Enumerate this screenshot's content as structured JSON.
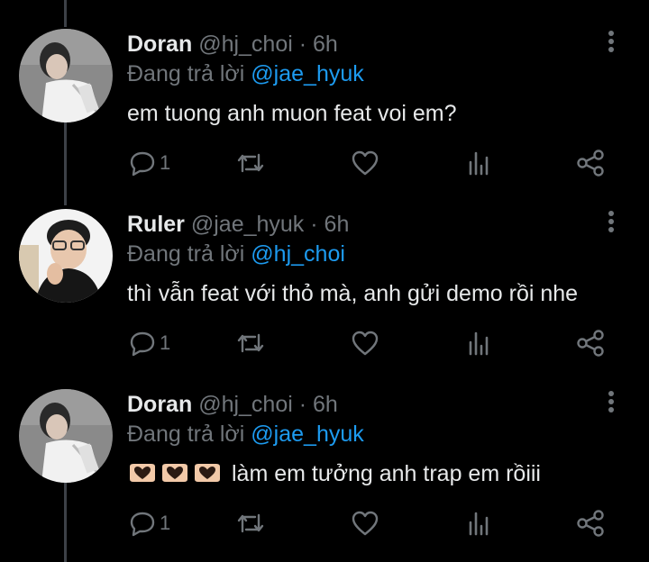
{
  "tweets": [
    {
      "name": "Doran",
      "handle": "@hj_choi",
      "dot": "·",
      "time": "6h",
      "reply_prefix": "Đang trả lời",
      "reply_to": "@jae_hyuk",
      "text": "em tuong anh muon feat voi em?",
      "reply_count": "1",
      "avatar": "doran-avatar"
    },
    {
      "name": "Ruler",
      "handle": "@jae_hyuk",
      "dot": "·",
      "time": "6h",
      "reply_prefix": "Đang trả lời",
      "reply_to": "@hj_choi",
      "text": "thì vẫn feat với thỏ mà, anh gửi demo rồi nhe",
      "reply_count": "1",
      "avatar": "ruler-avatar"
    },
    {
      "name": "Doran",
      "handle": "@hj_choi",
      "dot": "·",
      "time": "6h",
      "reply_prefix": "Đang trả lời",
      "reply_to": "@jae_hyuk",
      "text": "làm em tưởng anh trap em rồiii",
      "reply_count": "1",
      "avatar": "doran-avatar"
    }
  ],
  "colors": {
    "background": "#000000",
    "text": "#e7e9ea",
    "muted": "#71767b",
    "accent": "#1d9bf0",
    "thread_line": "#3d4147",
    "heart_emoji": "#f2c9a8"
  },
  "icons": [
    "more-vertical-icon",
    "reply-bubble-icon",
    "retweet-icon",
    "like-heart-icon",
    "analytics-bars-icon",
    "share-icon",
    "heart-hands-emoji"
  ]
}
